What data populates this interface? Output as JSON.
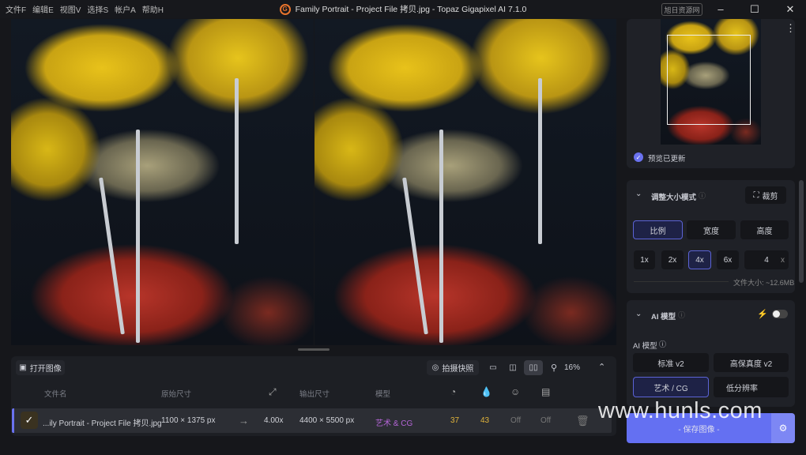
{
  "menu": [
    "文件F",
    "编辑E",
    "视图V",
    "选择S",
    "帐户A",
    "帮助H"
  ],
  "window": {
    "title": "Family Portrait - Project File 拷贝.jpg - Topaz Gigapixel AI 7.1.0",
    "badge": "旭日资源网",
    "logo": "G"
  },
  "preview": {
    "status": "预览已更新"
  },
  "resize": {
    "title": "调整大小模式",
    "crop": "裁剪",
    "modes": [
      "比例",
      "宽度",
      "高度"
    ],
    "scales": [
      "1x",
      "2x",
      "4x",
      "6x"
    ],
    "custom_value": "4",
    "custom_unit": "x",
    "file_size": "文件大小: ~12.6MB"
  },
  "ai": {
    "title": "AI 模型",
    "sub_label": "AI 模型",
    "models": [
      "标准 v2",
      "高保真度 v2",
      "艺术 / CG",
      "低分辨率"
    ]
  },
  "save": {
    "label": "- 保存图像 -"
  },
  "toolbar": {
    "open": "打开图像",
    "snapshot": "拍摄快照",
    "zoom": "16%"
  },
  "table": {
    "headers": {
      "filename": "文件名",
      "original": "原始尺寸",
      "output": "输出尺寸",
      "model": "模型"
    },
    "row": {
      "filename": "...ily Portrait - Project File 拷贝.jpg",
      "original": "1100 × 1375 px",
      "arrow": "→",
      "scale": "4.00x",
      "output": "4400 × 5500 px",
      "model": "艺术 & CG",
      "v1": "37",
      "v2": "43",
      "v3": "Off",
      "v4": "Off"
    }
  },
  "watermark": "www.hunls.com"
}
